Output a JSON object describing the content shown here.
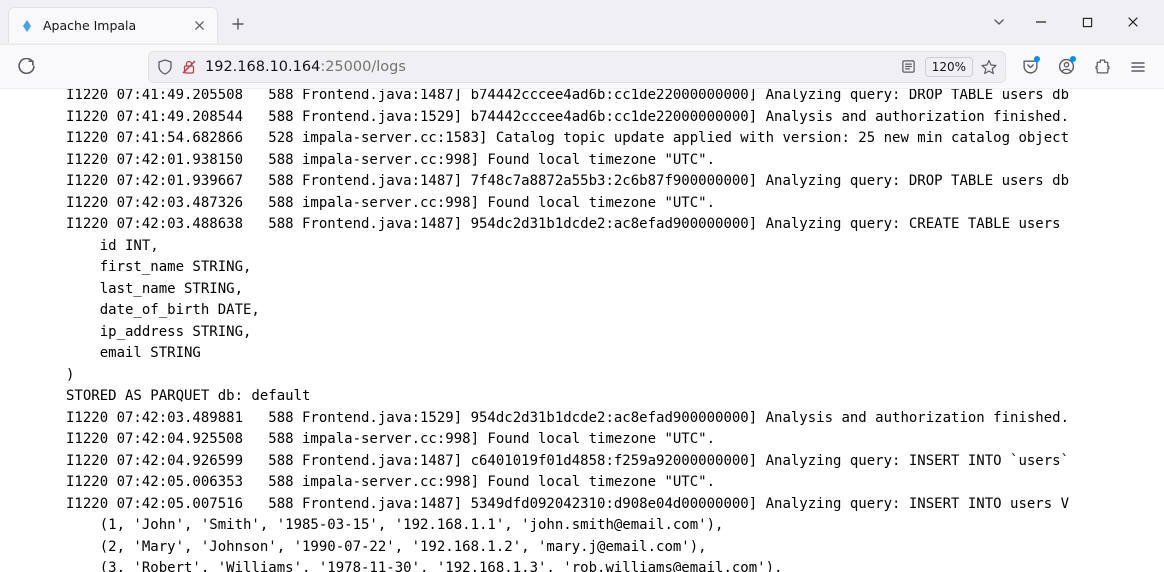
{
  "tab": {
    "title": "Apache Impala"
  },
  "url": {
    "host": "192.168.10.164",
    "rest": ":25000/logs"
  },
  "zoom": "120%",
  "log_lines": [
    "I1220 07:41:49.205508   588 Frontend.java:1487] b74442cccee4ad6b:cc1de22000000000] Analyzing query: DROP TABLE users db",
    "I1220 07:41:49.208544   588 Frontend.java:1529] b74442cccee4ad6b:cc1de22000000000] Analysis and authorization finished.",
    "I1220 07:41:54.682866   528 impala-server.cc:1583] Catalog topic update applied with version: 25 new min catalog object",
    "I1220 07:42:01.938150   588 impala-server.cc:998] Found local timezone \"UTC\".",
    "I1220 07:42:01.939667   588 Frontend.java:1487] 7f48c7a8872a55b3:2c6b87f900000000] Analyzing query: DROP TABLE users db",
    "I1220 07:42:03.487326   588 impala-server.cc:998] Found local timezone \"UTC\".",
    "I1220 07:42:03.488638   588 Frontend.java:1487] 954dc2d31b1dcde2:ac8efad900000000] Analyzing query: CREATE TABLE users ",
    "    id INT,",
    "    first_name STRING,",
    "    last_name STRING,",
    "    date_of_birth DATE,",
    "    ip_address STRING,",
    "    email STRING",
    ")",
    "STORED AS PARQUET db: default",
    "I1220 07:42:03.489881   588 Frontend.java:1529] 954dc2d31b1dcde2:ac8efad900000000] Analysis and authorization finished.",
    "I1220 07:42:04.925508   588 impala-server.cc:998] Found local timezone \"UTC\".",
    "I1220 07:42:04.926599   588 Frontend.java:1487] c6401019f01d4858:f259a92000000000] Analyzing query: INSERT INTO `users`",
    "I1220 07:42:05.006353   588 impala-server.cc:998] Found local timezone \"UTC\".",
    "I1220 07:42:05.007516   588 Frontend.java:1487] 5349dfd092042310:d908e04d00000000] Analyzing query: INSERT INTO users V",
    "    (1, 'John', 'Smith', '1985-03-15', '192.168.1.1', 'john.smith@email.com'),",
    "    (2, 'Mary', 'Johnson', '1990-07-22', '192.168.1.2', 'mary.j@email.com'),",
    "    (3, 'Robert', 'Williams', '1978-11-30', '192.168.1.3', 'rob.williams@email.com'),"
  ]
}
